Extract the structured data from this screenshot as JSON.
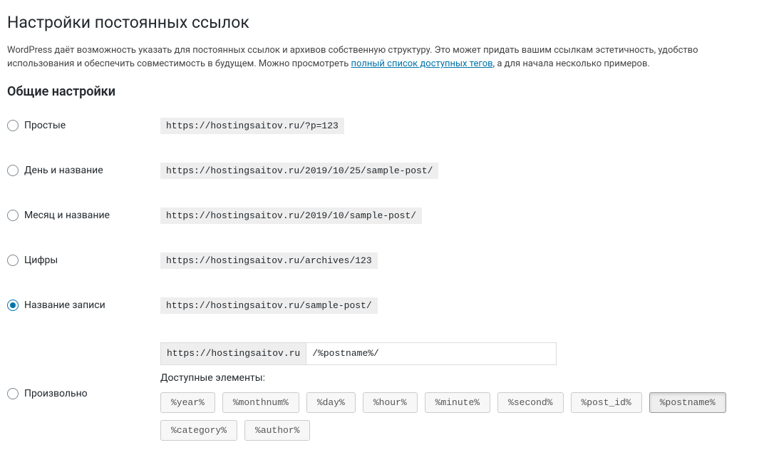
{
  "page": {
    "title": "Настройки постоянных ссылок",
    "description_before_link": "WordPress даёт возможность указать для постоянных ссылок и архивов собственную структуру. Это может придать вашим ссылкам эстетичность, удобство использования и обеспечить совместимость в будущем. Можно просмотреть ",
    "description_link_text": "полный список доступных тегов",
    "description_after_link": ", а для начала несколько примеров."
  },
  "section_heading": "Общие настройки",
  "options": [
    {
      "id": "plain",
      "label": "Простые",
      "example": "https://hostingsaitov.ru/?p=123",
      "checked": false
    },
    {
      "id": "day-name",
      "label": "День и название",
      "example": "https://hostingsaitov.ru/2019/10/25/sample-post/",
      "checked": false
    },
    {
      "id": "month-name",
      "label": "Месяц и название",
      "example": "https://hostingsaitov.ru/2019/10/sample-post/",
      "checked": false
    },
    {
      "id": "numeric",
      "label": "Цифры",
      "example": "https://hostingsaitov.ru/archives/123",
      "checked": false
    },
    {
      "id": "post-name",
      "label": "Название записи",
      "example": "https://hostingsaitov.ru/sample-post/",
      "checked": true
    }
  ],
  "custom": {
    "label": "Произвольно",
    "prefix": "https://hostingsaitov.ru",
    "value": "/%postname%/",
    "checked": false,
    "available_label": "Доступные элементы:",
    "tags": [
      {
        "text": "%year%",
        "active": false
      },
      {
        "text": "%monthnum%",
        "active": false
      },
      {
        "text": "%day%",
        "active": false
      },
      {
        "text": "%hour%",
        "active": false
      },
      {
        "text": "%minute%",
        "active": false
      },
      {
        "text": "%second%",
        "active": false
      },
      {
        "text": "%post_id%",
        "active": false
      },
      {
        "text": "%postname%",
        "active": true
      },
      {
        "text": "%category%",
        "active": false
      },
      {
        "text": "%author%",
        "active": false
      }
    ]
  }
}
